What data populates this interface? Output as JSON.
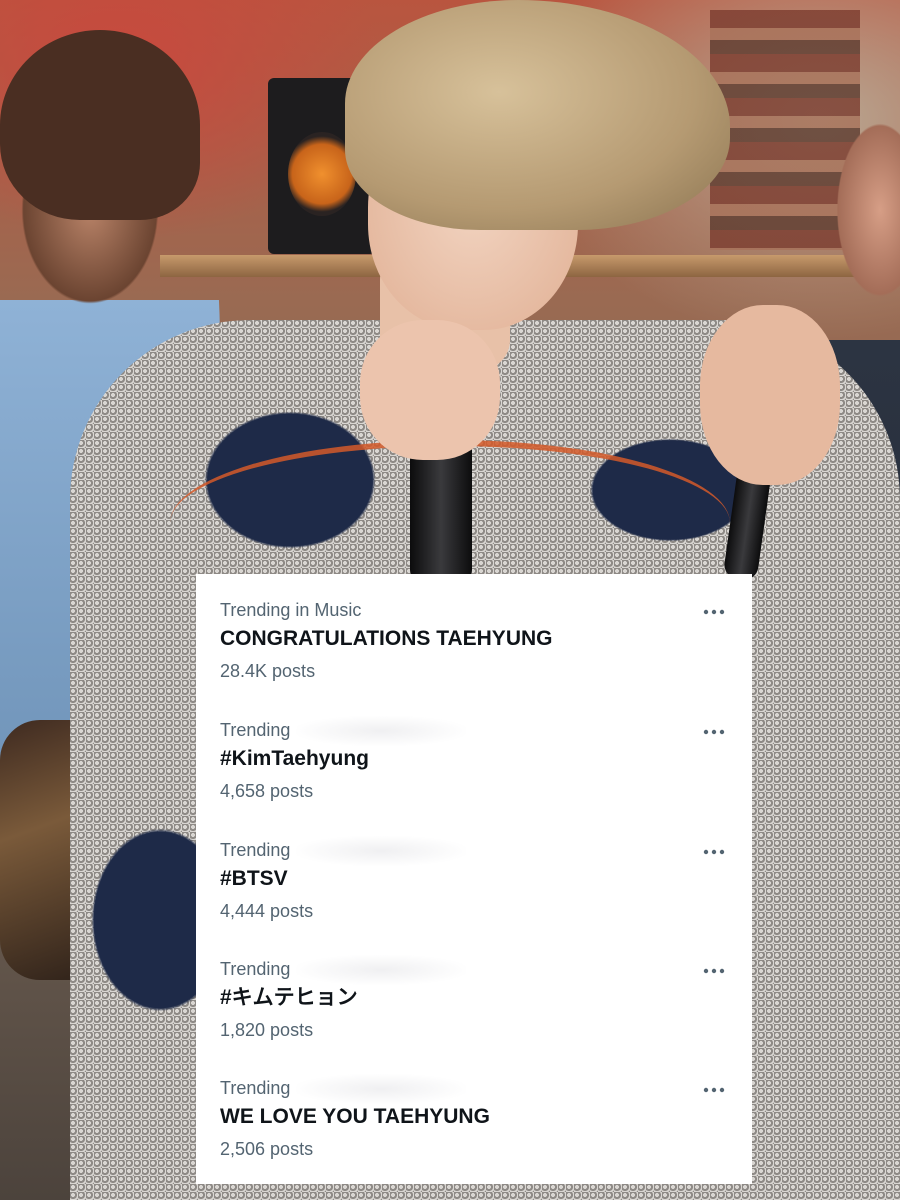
{
  "trends": [
    {
      "context": "Trending in Music",
      "title": "CONGRATULATIONS TAEHYUNG",
      "posts": "28.4K posts",
      "more_icon": "more-horizontal-icon"
    },
    {
      "context": "Trending",
      "title": "#KimTaehyung",
      "posts": "4,658 posts",
      "more_icon": "more-horizontal-icon"
    },
    {
      "context": "Trending",
      "title": "#BTSV",
      "posts": "4,444 posts",
      "more_icon": "more-horizontal-icon"
    },
    {
      "context": "Trending",
      "title": "#キムテヒョン",
      "posts": "1,820 posts",
      "more_icon": "more-horizontal-icon"
    },
    {
      "context": "Trending",
      "title": "WE LOVE YOU TAEHYUNG",
      "posts": "2,506 posts",
      "more_icon": "more-horizontal-icon"
    }
  ],
  "colors": {
    "card_background": "#ffffff",
    "primary_text": "#0f1419",
    "secondary_text": "#536471"
  }
}
